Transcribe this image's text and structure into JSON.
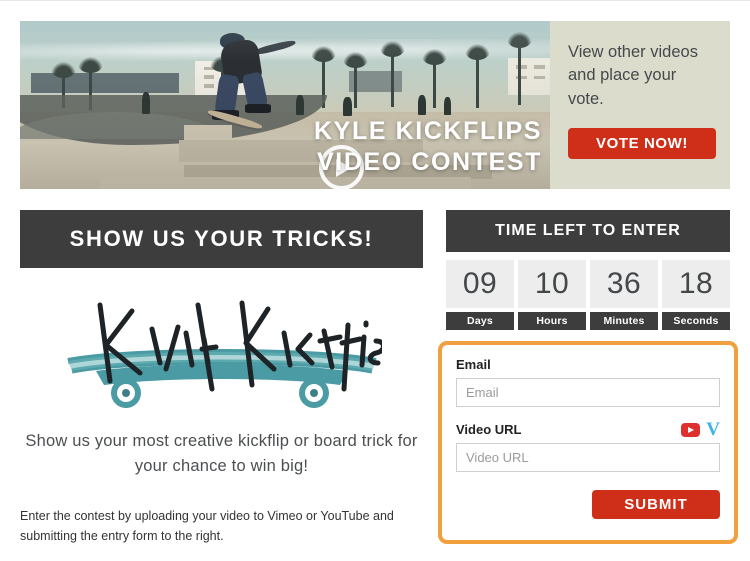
{
  "hero": {
    "play_icon": "play-circle-icon",
    "title_line1": "KYLE KICKFLIPS",
    "title_line2": "VIDEO CONTEST",
    "aside_text": "View other videos and place your vote.",
    "vote_button": "VOTE NOW!",
    "aside_bg": "#dcdccc",
    "vote_button_color": "#cf2e18"
  },
  "left": {
    "banner": "SHOW US YOUR TRICKS!",
    "banner_bg": "#3d3d3d",
    "logo_text": "Kyle Kickflips",
    "logo_board_color": "#4a9ba3",
    "tagline": "Show us your most creative kickflip or board trick for your chance to win big!",
    "small_copy": "Enter the contest by uploading your video to Vimeo or YouTube and submitting the entry form to the right."
  },
  "timer": {
    "header": "TIME LEFT TO ENTER",
    "cells": [
      {
        "value": "09",
        "label": "Days"
      },
      {
        "value": "10",
        "label": "Hours"
      },
      {
        "value": "36",
        "label": "Minutes"
      },
      {
        "value": "18",
        "label": "Seconds"
      }
    ]
  },
  "form": {
    "border_color": "#f0a03c",
    "email_label": "Email",
    "email_value": "",
    "email_placeholder": "Email",
    "video_label": "Video URL",
    "video_value": "",
    "video_placeholder": "Video URL",
    "youtube_icon": "youtube-icon",
    "vimeo_icon": "vimeo-icon",
    "vimeo_glyph": "V",
    "submit_label": "SUBMIT",
    "submit_color": "#cf2e18"
  }
}
